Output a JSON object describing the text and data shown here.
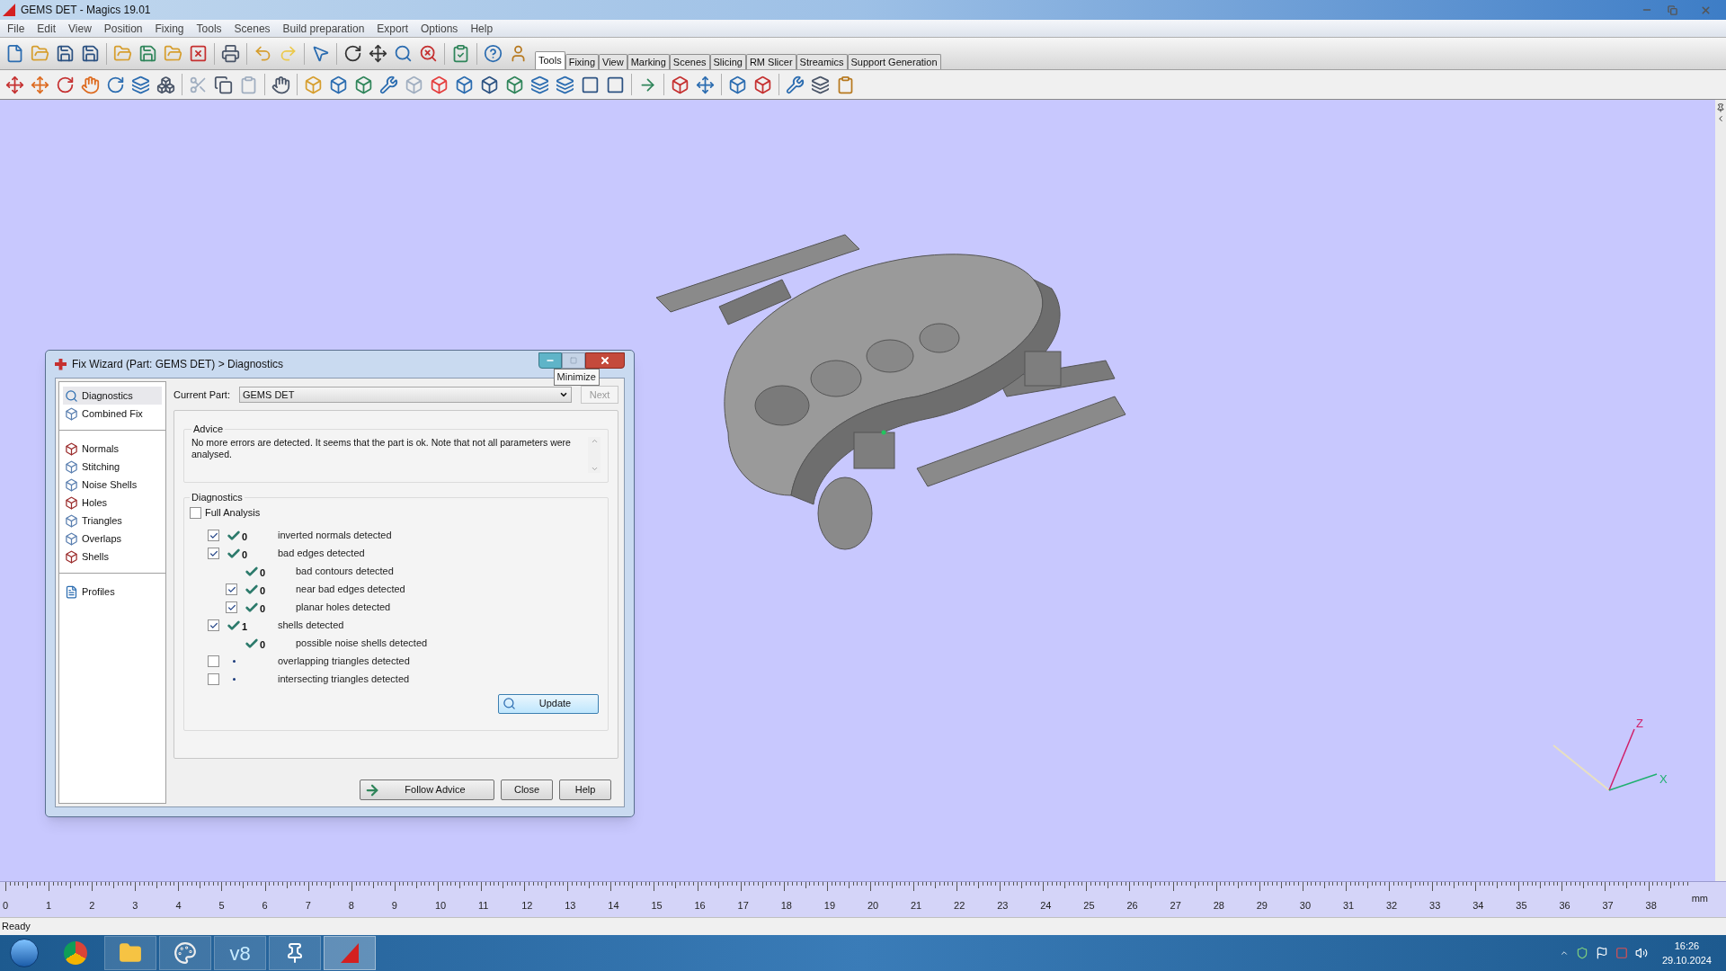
{
  "window": {
    "title": "GEMS DET - Magics 19.01"
  },
  "menu": [
    "File",
    "Edit",
    "View",
    "Position",
    "Fixing",
    "Tools",
    "Scenes",
    "Build preparation",
    "Export",
    "Options",
    "Help"
  ],
  "ribbon_tabs": [
    {
      "label": "Tools",
      "selected": true
    },
    {
      "label": "Fixing",
      "selected": false
    },
    {
      "label": "View",
      "selected": false
    },
    {
      "label": "Marking",
      "selected": false
    },
    {
      "label": "Scenes",
      "selected": false
    },
    {
      "label": "Slicing",
      "selected": false
    },
    {
      "label": "RM Slicer",
      "selected": false
    },
    {
      "label": "Streamics",
      "selected": false
    },
    {
      "label": "Support Generation",
      "selected": false
    }
  ],
  "dialog": {
    "title": "Fix Wizard (Part: GEMS DET) > Diagnostics",
    "tooltip": "Minimize",
    "sidebar": [
      [
        {
          "label": "Diagnostics",
          "selected": true
        },
        {
          "label": "Combined Fix",
          "selected": false
        }
      ],
      [
        {
          "label": "Normals",
          "selected": false
        },
        {
          "label": "Stitching",
          "selected": false
        },
        {
          "label": "Noise Shells",
          "selected": false
        },
        {
          "label": "Holes",
          "selected": false
        },
        {
          "label": "Triangles",
          "selected": false
        },
        {
          "label": "Overlaps",
          "selected": false
        },
        {
          "label": "Shells",
          "selected": false
        }
      ],
      [
        {
          "label": "Profiles",
          "selected": false
        }
      ]
    ],
    "current_part_label": "Current Part:",
    "current_part": "GEMS DET",
    "next_button": {
      "label": "Next",
      "disabled": true
    },
    "advice": {
      "heading": "Advice",
      "text": "No more errors are detected. It seems that the part is ok. Note that not all parameters were analysed."
    },
    "diagnostics": {
      "heading": "Diagnostics",
      "full_analysis": {
        "label": "Full Analysis",
        "checked": false
      },
      "rows": [
        {
          "kind": "check",
          "checked": true,
          "passed": true,
          "count": "0",
          "label": "inverted normals detected"
        },
        {
          "kind": "check",
          "checked": true,
          "passed": true,
          "count": "0",
          "label": "bad edges detected",
          "children": [
            {
              "kind": "plain",
              "passed": true,
              "count": "0",
              "label": "bad contours detected"
            },
            {
              "kind": "check",
              "checked": true,
              "passed": true,
              "count": "0",
              "label": "near bad edges detected"
            },
            {
              "kind": "check",
              "checked": true,
              "passed": true,
              "count": "0",
              "label": "planar holes detected"
            }
          ]
        },
        {
          "kind": "check",
          "checked": true,
          "passed": true,
          "count": "1",
          "label": "shells detected",
          "children": [
            {
              "kind": "plain",
              "passed": true,
              "count": "0",
              "label": "possible noise shells detected"
            }
          ]
        },
        {
          "kind": "check",
          "checked": false,
          "passed": false,
          "label": "overlapping triangles detected"
        },
        {
          "kind": "check",
          "checked": false,
          "passed": false,
          "label": "intersecting triangles detected"
        }
      ]
    },
    "update_button": "Update",
    "buttons": [
      "Follow Advice",
      "Close",
      "Help"
    ]
  },
  "viewport": {
    "axes": {
      "z": "Z",
      "x": "X"
    }
  },
  "ruler": {
    "labels": [
      "0",
      "1",
      "2",
      "3",
      "4",
      "5",
      "6",
      "7",
      "8",
      "9",
      "10",
      "11",
      "12",
      "13",
      "14",
      "15",
      "16",
      "17",
      "18",
      "19",
      "20",
      "21",
      "22",
      "23",
      "24",
      "25",
      "26",
      "27",
      "28",
      "29",
      "30",
      "31",
      "32",
      "33",
      "34",
      "35",
      "36",
      "37",
      "38"
    ],
    "unit": "mm"
  },
  "status_bar": "Ready",
  "taskbar": {
    "app_badge": "v8",
    "time": "16:26",
    "date": "29.10.2024"
  }
}
